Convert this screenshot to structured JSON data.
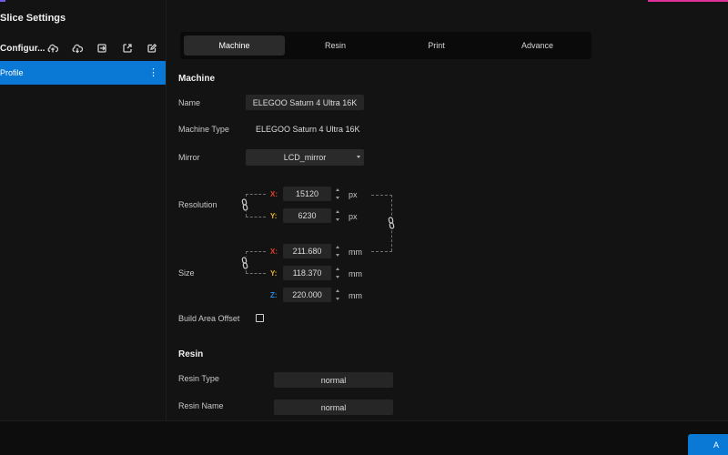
{
  "window": {
    "title": "Slice Settings"
  },
  "sidebar": {
    "config_label": "Configur...",
    "toolbar_icons": [
      "cloud-upload-icon",
      "cloud-download-icon",
      "import-icon",
      "export-icon",
      "edit-icon"
    ],
    "profile": {
      "label": "Profile",
      "menu": "⋮"
    }
  },
  "tabs": [
    {
      "label": "Machine",
      "active": true
    },
    {
      "label": "Resin",
      "active": false
    },
    {
      "label": "Print",
      "active": false
    },
    {
      "label": "Advance",
      "active": false
    }
  ],
  "machine": {
    "heading": "Machine",
    "name_label": "Name",
    "name_value": "ELEGOO Saturn 4 Ultra 16K",
    "type_label": "Machine Type",
    "type_value": "ELEGOO Saturn 4 Ultra 16K",
    "mirror_label": "Mirror",
    "mirror_value": "LCD_mirror",
    "resolution_label": "Resolution",
    "resolution": {
      "x_axis": "X:",
      "x_value": "15120",
      "x_unit": "px",
      "y_axis": "Y:",
      "y_value": "6230",
      "y_unit": "px"
    },
    "size_label": "Size",
    "size": {
      "x_axis": "X:",
      "x_value": "211.680",
      "x_unit": "mm",
      "y_axis": "Y:",
      "y_value": "118.370",
      "y_unit": "mm",
      "z_axis": "Z:",
      "z_value": "220.000",
      "z_unit": "mm"
    },
    "build_offset_label": "Build Area Offset",
    "build_offset_checked": false
  },
  "resin": {
    "heading": "Resin",
    "type_label": "Resin Type",
    "type_value": "normal",
    "name_label": "Resin Name",
    "name_value": "normal"
  },
  "footer": {
    "apply_label": "A"
  },
  "colors": {
    "accent": "#0a79d6",
    "axis_x": "#e2412b",
    "axis_y": "#e7b12c",
    "axis_z": "#2e8de0"
  }
}
